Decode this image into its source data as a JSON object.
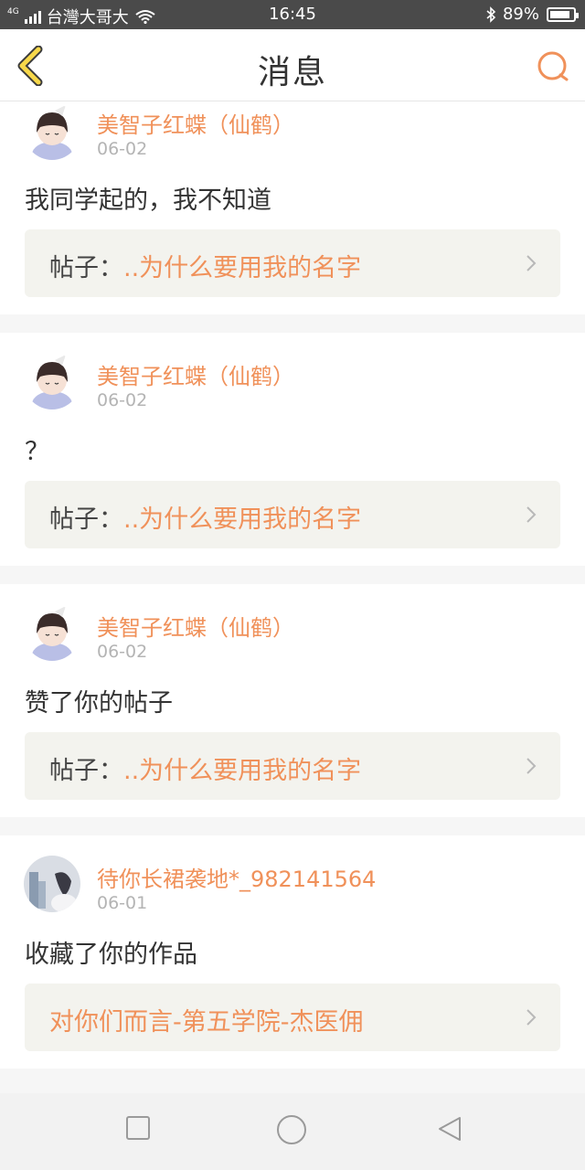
{
  "status_bar": {
    "network": "4G",
    "carrier": "台灣大哥大",
    "time": "16:45",
    "battery_text": "89%",
    "battery_level": 0.89,
    "icons": [
      "signal-icon",
      "wifi-icon",
      "bluetooth-icon",
      "battery-icon"
    ]
  },
  "header": {
    "title": "消息",
    "back_icon": "chevron-left-icon",
    "search_icon": "search-icon"
  },
  "colors": {
    "accent": "#f0915a",
    "back_yellow": "#f7d84a",
    "text_dark": "#333333",
    "text_muted": "#b4b4b4",
    "postbox_bg": "#f3f3ee"
  },
  "messages": [
    {
      "username": "美智子红蝶（仙鹤）",
      "date": "06-02",
      "content": "我同学起的，我不知道",
      "post_prefix": "帖子：",
      "post_title": "..为什么要用我的名字"
    },
    {
      "username": "美智子红蝶（仙鹤）",
      "date": "06-02",
      "content": "？",
      "post_prefix": "帖子：",
      "post_title": "..为什么要用我的名字"
    },
    {
      "username": "美智子红蝶（仙鹤）",
      "date": "06-02",
      "content": "赞了你的帖子",
      "post_prefix": "帖子：",
      "post_title": "..为什么要用我的名字"
    },
    {
      "username": "待你长裙袭地*_982141564",
      "date": "06-01",
      "content": "收藏了你的作品",
      "post_prefix": "",
      "post_title": "对你们而言-第五学院-杰医佣"
    }
  ],
  "nav_bar": {
    "icons": [
      "recent-apps-icon",
      "home-icon",
      "back-triangle-icon"
    ]
  }
}
